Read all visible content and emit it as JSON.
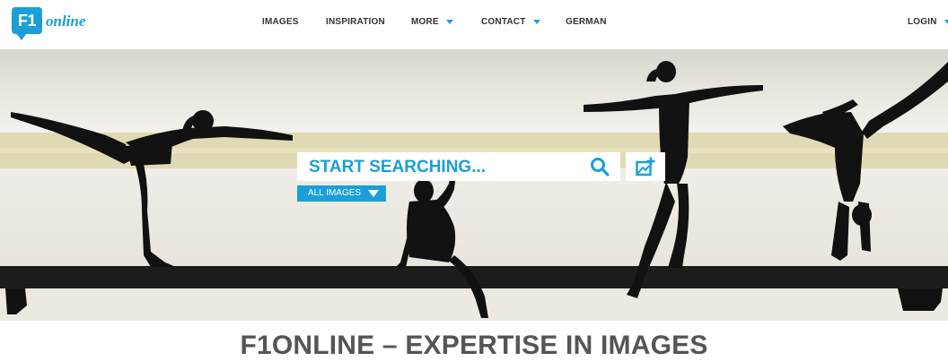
{
  "brand": {
    "mark": "F1",
    "name": "online"
  },
  "nav": {
    "items": [
      {
        "label": "IMAGES"
      },
      {
        "label": "INSPIRATION"
      },
      {
        "label": "MORE"
      },
      {
        "label": "CONTACT"
      },
      {
        "label": "GERMAN"
      }
    ],
    "login": "LOGIN"
  },
  "hero": {
    "search_placeholder": "START SEARCHING...",
    "filter_selected": "ALL IMAGES"
  },
  "headline": "F1ONLINE – EXPERTISE IN IMAGES",
  "colors": {
    "accent": "#1a9fd8",
    "text": "#333333",
    "headline": "#555555"
  },
  "icons": [
    "search-icon",
    "image-upload-icon",
    "chevron-down-icon"
  ]
}
